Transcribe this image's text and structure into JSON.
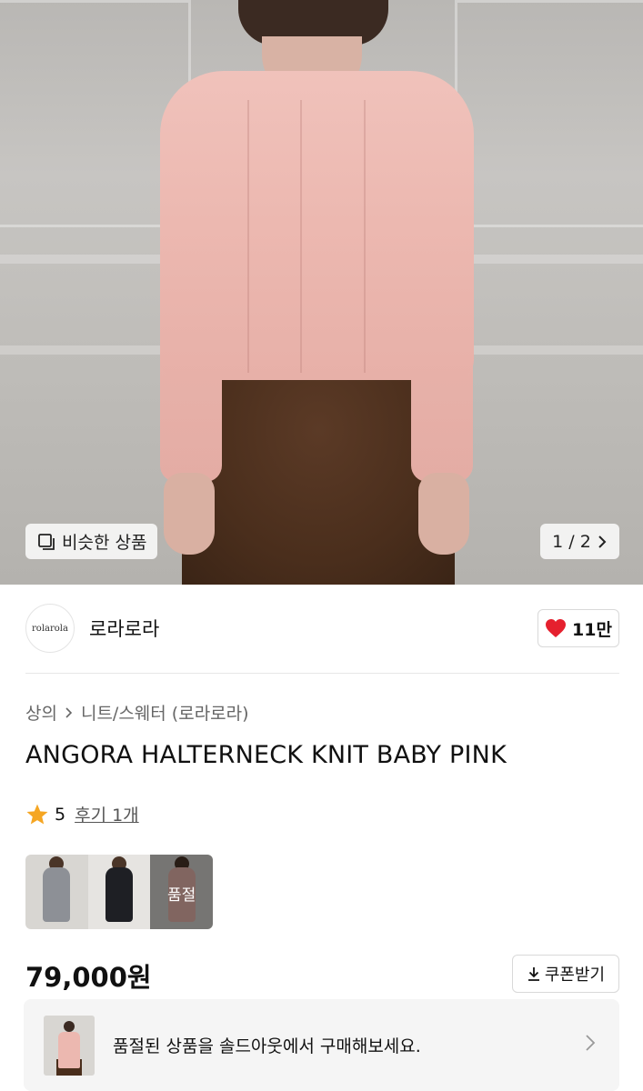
{
  "hero": {
    "similar_label": "비슷한 상품",
    "pager": "1 / 2",
    "icons": {
      "similar": "similar-items-icon",
      "next": "chevron-right-icon"
    }
  },
  "seller": {
    "logo_text": "rolarola",
    "name": "로라로라",
    "likes": "11만",
    "like_color": "#e5202e"
  },
  "breadcrumb": {
    "level1": "상의",
    "level2": "니트/스웨터 (로라로라)"
  },
  "product": {
    "title": "ANGORA HALTERNECK KNIT BABY PINK",
    "rating": "5",
    "reviews": "후기 1개",
    "star_color": "#f5a623",
    "sold_label": "품절",
    "price": "79,000원",
    "coupon_label": "쿠폰받기"
  },
  "banner": {
    "text": "품절된 상품을 솔드아웃에서 구매해보세요."
  }
}
